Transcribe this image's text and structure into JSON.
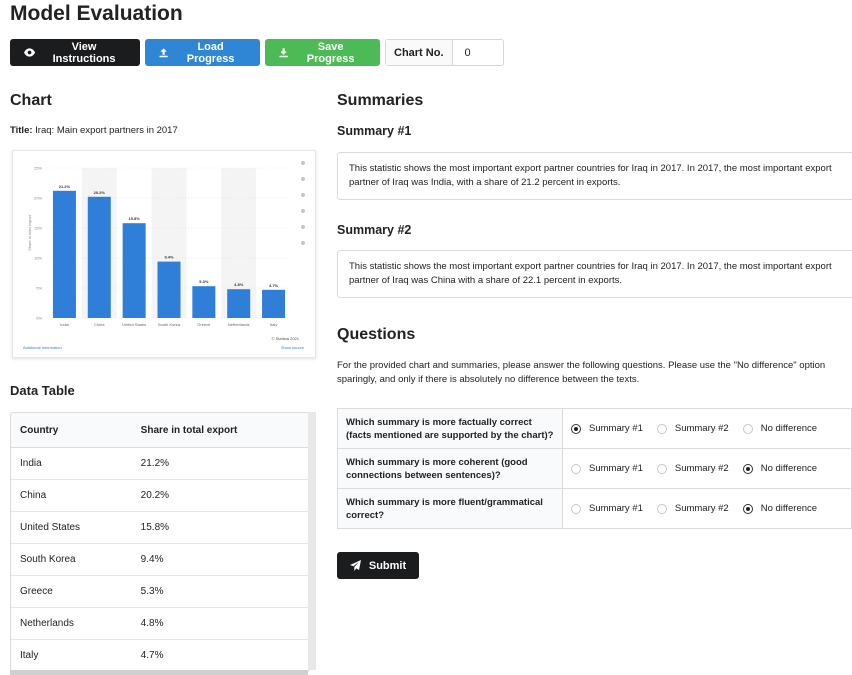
{
  "page": {
    "title": "Model Evaluation"
  },
  "toolbar": {
    "view_instructions": "View Instructions",
    "load_progress": "Load Progress",
    "save_progress": "Save Progress",
    "chart_no_label": "Chart No.",
    "chart_no_value": "0"
  },
  "chart_section": {
    "heading": "Chart",
    "title_label": "Title:",
    "title_value": "Iraq: Main export partners in 2017",
    "additional_info": "Additional Information",
    "credit": "© Statista 2021",
    "show_source": "Show source"
  },
  "chart_data": {
    "type": "bar",
    "categories": [
      "India",
      "China",
      "United States",
      "South Korea",
      "Greece",
      "Netherlands",
      "Italy"
    ],
    "values": [
      21.2,
      20.2,
      15.8,
      9.4,
      5.3,
      4.8,
      4.7
    ],
    "data_labels": [
      "21.2%",
      "20.2%",
      "15.8%",
      "9.4%",
      "5.3%",
      "4.8%",
      "4.7%"
    ],
    "ylabel": "Share in total export",
    "yticks": [
      "0%",
      "5%",
      "10%",
      "15%",
      "20%",
      "25%"
    ],
    "ylim": [
      0,
      25
    ],
    "bar_color": "#2f7ed8",
    "grid": true
  },
  "data_table": {
    "heading": "Data Table",
    "columns": [
      "Country",
      "Share in total export"
    ],
    "rows": [
      [
        "India",
        "21.2%"
      ],
      [
        "China",
        "20.2%"
      ],
      [
        "United States",
        "15.8%"
      ],
      [
        "South Korea",
        "9.4%"
      ],
      [
        "Greece",
        "5.3%"
      ],
      [
        "Netherlands",
        "4.8%"
      ],
      [
        "Italy",
        "4.7%"
      ]
    ]
  },
  "summaries": {
    "heading": "Summaries",
    "items": [
      {
        "label": "Summary #1",
        "text": "This statistic shows the most important export partner countries for Iraq in 2017. In 2017, the most important export partner of Iraq was India, with a share of 21.2 percent in exports."
      },
      {
        "label": "Summary #2",
        "text": "This statistic shows the most important export partner countries for Iraq in 2017. In 2017, the most important export partner of Iraq was China with a share of 22.1 percent in exports."
      }
    ]
  },
  "questions": {
    "heading": "Questions",
    "intro": "For the provided chart and summaries, please answer the following questions. Please use the \"No difference\" option sparingly, and only if there is absolutely no difference between the texts.",
    "options": [
      "Summary #1",
      "Summary #2",
      "No difference"
    ],
    "items": [
      {
        "text": "Which summary is more factually correct (facts mentioned are supported by the chart)?",
        "selected": 0
      },
      {
        "text": "Which summary is more coherent (good connections between sentences)?",
        "selected": 2
      },
      {
        "text": "Which summary is more fluent/grammatical correct?",
        "selected": 2
      }
    ]
  },
  "submit_label": "Submit",
  "colors": {
    "dark": "#1b1c1d",
    "blue": "#2f86d4",
    "green": "#4dbb55"
  }
}
